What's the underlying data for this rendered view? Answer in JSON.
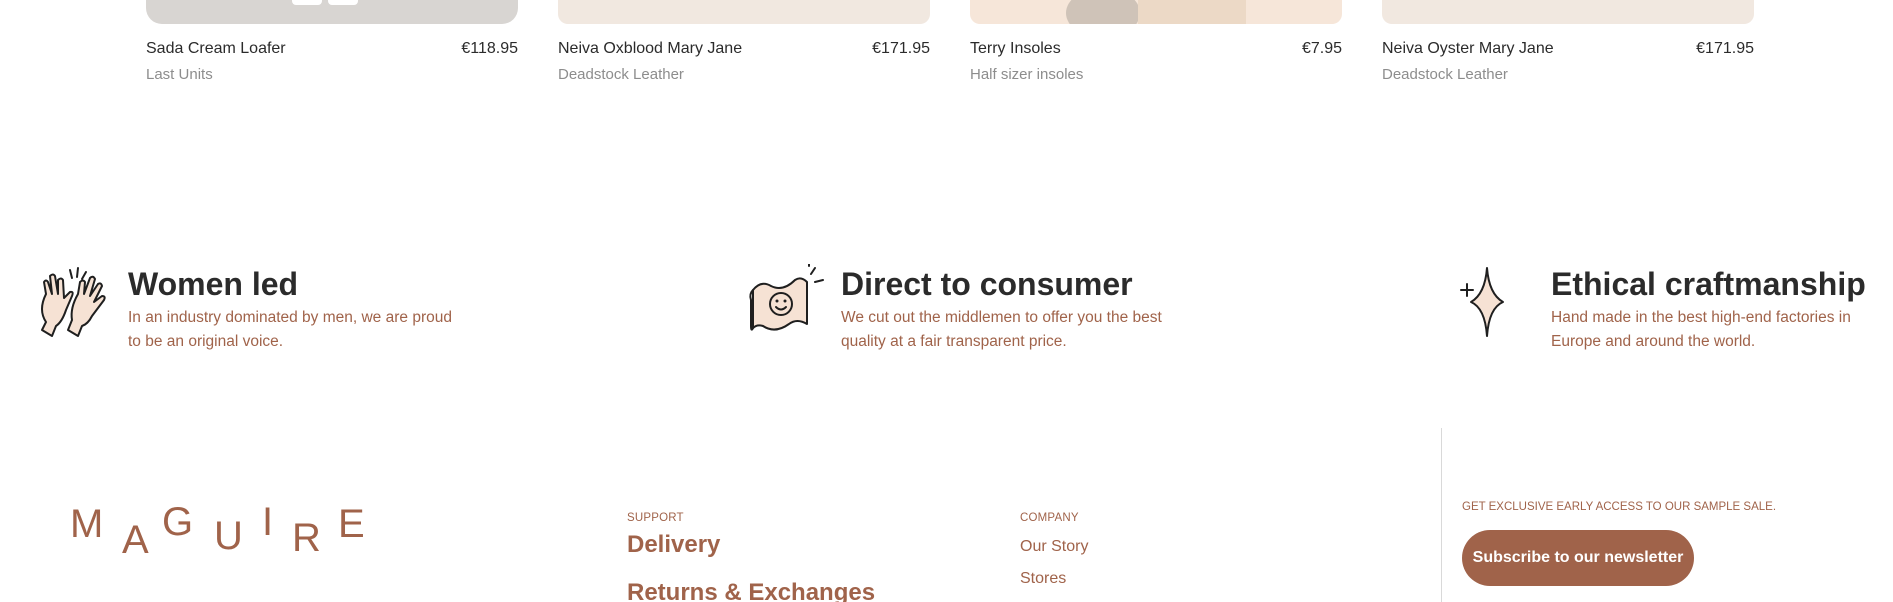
{
  "products": [
    {
      "name": "Sada Cream Loafer",
      "price": "€118.95",
      "subtitle": "Last Units",
      "image_tone": "grey"
    },
    {
      "name": "Neiva Oxblood Mary Jane",
      "price": "€171.95",
      "subtitle": "Deadstock Leather",
      "image_tone": "beige"
    },
    {
      "name": "Terry Insoles",
      "price": "€7.95",
      "subtitle": "Half sizer insoles",
      "image_tone": "peach"
    },
    {
      "name": "Neiva Oyster Mary Jane",
      "price": "€171.95",
      "subtitle": "Deadstock Leather",
      "image_tone": "beige"
    }
  ],
  "features": [
    {
      "icon": "clapping-hands-icon",
      "title": "Women led",
      "text": "In an industry dominated by men, we are proud to be an original voice."
    },
    {
      "icon": "smiley-banknote-icon",
      "title": "Direct to consumer",
      "text": "We cut out the middlemen to offer you the best quality at a fair transparent price."
    },
    {
      "icon": "sparkle-icon",
      "title": "Ethical craftmanship",
      "text": "Hand made in the best high-end factories in Europe and around the world."
    }
  ],
  "footer": {
    "logo": [
      "M",
      "A",
      "G",
      "U",
      "I",
      "R",
      "E"
    ],
    "support": {
      "heading": "SUPPORT",
      "links": [
        "Delivery",
        "Returns & Exchanges"
      ]
    },
    "company": {
      "heading": "COMPANY",
      "links": [
        "Our Story",
        "Stores"
      ]
    },
    "newsletter": {
      "heading": "GET EXCLUSIVE EARLY ACCESS TO OUR SAMPLE SALE.",
      "button": "Subscribe to our newsletter"
    }
  },
  "colors": {
    "accent": "#a0634a",
    "text": "#2b2b2b",
    "muted": "#8d8d8d"
  }
}
